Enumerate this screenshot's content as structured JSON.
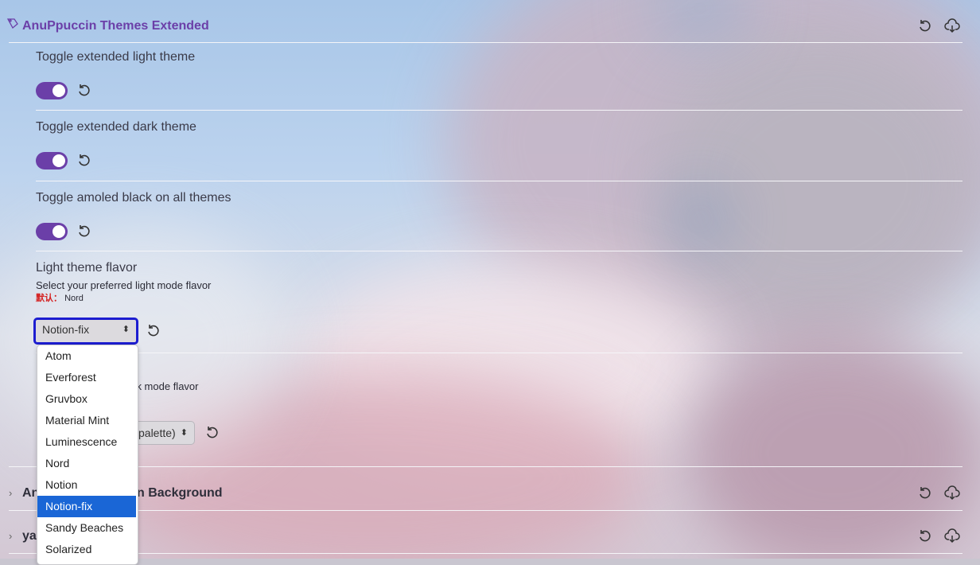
{
  "header": {
    "title": "AnuPpuccin Themes Extended"
  },
  "settings": [
    {
      "label": "Toggle extended light theme"
    },
    {
      "label": "Toggle extended dark theme"
    },
    {
      "label": "Toggle amoled black on all themes"
    }
  ],
  "light_flavor": {
    "label": "Light theme flavor",
    "description": "Select your preferred light mode flavor",
    "default_key": "默认：",
    "default_value": "Nord",
    "selected": "Notion-fix"
  },
  "dark_flavor": {
    "description_visible": "lark mode flavor",
    "selected_visible": "palette)"
  },
  "dropdown": {
    "options": [
      "Atom",
      "Everforest",
      "Gruvbox",
      "Material Mint",
      "Luminescence",
      "Nord",
      "Notion",
      "Notion-fix",
      "Sandy Beaches",
      "Solarized"
    ],
    "selected_index": 7
  },
  "sections": [
    {
      "title_left": "An",
      "title_right": "n Background"
    },
    {
      "title_left": "ya"
    }
  ],
  "colors": {
    "accent": "#6b3fa8",
    "selection": "#1a66d6",
    "focus_ring": "#1d1dd0"
  }
}
